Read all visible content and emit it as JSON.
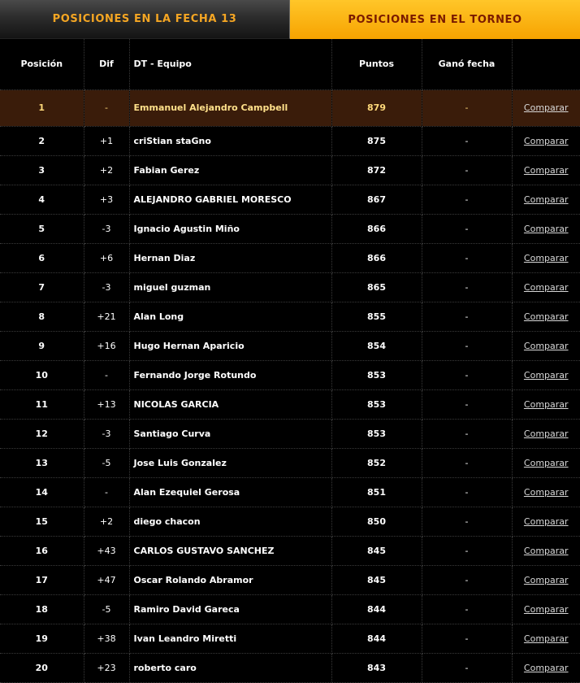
{
  "tabs": {
    "fecha": "POSICIONES EN LA FECHA 13",
    "torneo": "POSICIONES EN EL TORNEO"
  },
  "headers": {
    "pos": "Posición",
    "dif": "Dif",
    "team": "DT - Equipo",
    "points": "Puntos",
    "won": "Ganó fecha",
    "cmp": ""
  },
  "rows": [
    {
      "pos": "1",
      "dif": "-",
      "team": "Emmanuel Alejandro Campbell",
      "points": "879",
      "won": "-",
      "cmp": "Comparar"
    },
    {
      "pos": "2",
      "dif": "+1",
      "team": "criStian staGno",
      "points": "875",
      "won": "-",
      "cmp": "Comparar"
    },
    {
      "pos": "3",
      "dif": "+2",
      "team": "Fabian Gerez",
      "points": "872",
      "won": "-",
      "cmp": "Comparar"
    },
    {
      "pos": "4",
      "dif": "+3",
      "team": "ALEJANDRO GABRIEL MORESCO",
      "points": "867",
      "won": "-",
      "cmp": "Comparar"
    },
    {
      "pos": "5",
      "dif": "-3",
      "team": "Ignacio Agustin Miño",
      "points": "866",
      "won": "-",
      "cmp": "Comparar"
    },
    {
      "pos": "6",
      "dif": "+6",
      "team": "Hernan Diaz",
      "points": "866",
      "won": "-",
      "cmp": "Comparar"
    },
    {
      "pos": "7",
      "dif": "-3",
      "team": "miguel guzman",
      "points": "865",
      "won": "-",
      "cmp": "Comparar"
    },
    {
      "pos": "8",
      "dif": "+21",
      "team": "Alan Long",
      "points": "855",
      "won": "-",
      "cmp": "Comparar"
    },
    {
      "pos": "9",
      "dif": "+16",
      "team": "Hugo Hernan Aparicio",
      "points": "854",
      "won": "-",
      "cmp": "Comparar"
    },
    {
      "pos": "10",
      "dif": "-",
      "team": "Fernando Jorge Rotundo",
      "points": "853",
      "won": "-",
      "cmp": "Comparar"
    },
    {
      "pos": "11",
      "dif": "+13",
      "team": "NICOLAS GARCIA",
      "points": "853",
      "won": "-",
      "cmp": "Comparar"
    },
    {
      "pos": "12",
      "dif": "-3",
      "team": "Santiago Curva",
      "points": "853",
      "won": "-",
      "cmp": "Comparar"
    },
    {
      "pos": "13",
      "dif": "-5",
      "team": "Jose Luis Gonzalez",
      "points": "852",
      "won": "-",
      "cmp": "Comparar"
    },
    {
      "pos": "14",
      "dif": "-",
      "team": "Alan Ezequiel Gerosa",
      "points": "851",
      "won": "-",
      "cmp": "Comparar"
    },
    {
      "pos": "15",
      "dif": "+2",
      "team": "diego chacon",
      "points": "850",
      "won": "-",
      "cmp": "Comparar"
    },
    {
      "pos": "16",
      "dif": "+43",
      "team": "CARLOS GUSTAVO SANCHEZ",
      "points": "845",
      "won": "-",
      "cmp": "Comparar"
    },
    {
      "pos": "17",
      "dif": "+47",
      "team": "Oscar Rolando Abramor",
      "points": "845",
      "won": "-",
      "cmp": "Comparar"
    },
    {
      "pos": "18",
      "dif": "-5",
      "team": "Ramiro David Gareca",
      "points": "844",
      "won": "-",
      "cmp": "Comparar"
    },
    {
      "pos": "19",
      "dif": "+38",
      "team": "Ivan Leandro Miretti",
      "points": "844",
      "won": "-",
      "cmp": "Comparar"
    },
    {
      "pos": "20",
      "dif": "+23",
      "team": "roberto caro",
      "points": "843",
      "won": "-",
      "cmp": "Comparar"
    }
  ],
  "colors": {
    "accent_orange": "#f7a300",
    "tab_active_text": "#7a1a00",
    "tab_inactive_text": "#f5a623",
    "highlight_row": "#3a1c0a"
  }
}
